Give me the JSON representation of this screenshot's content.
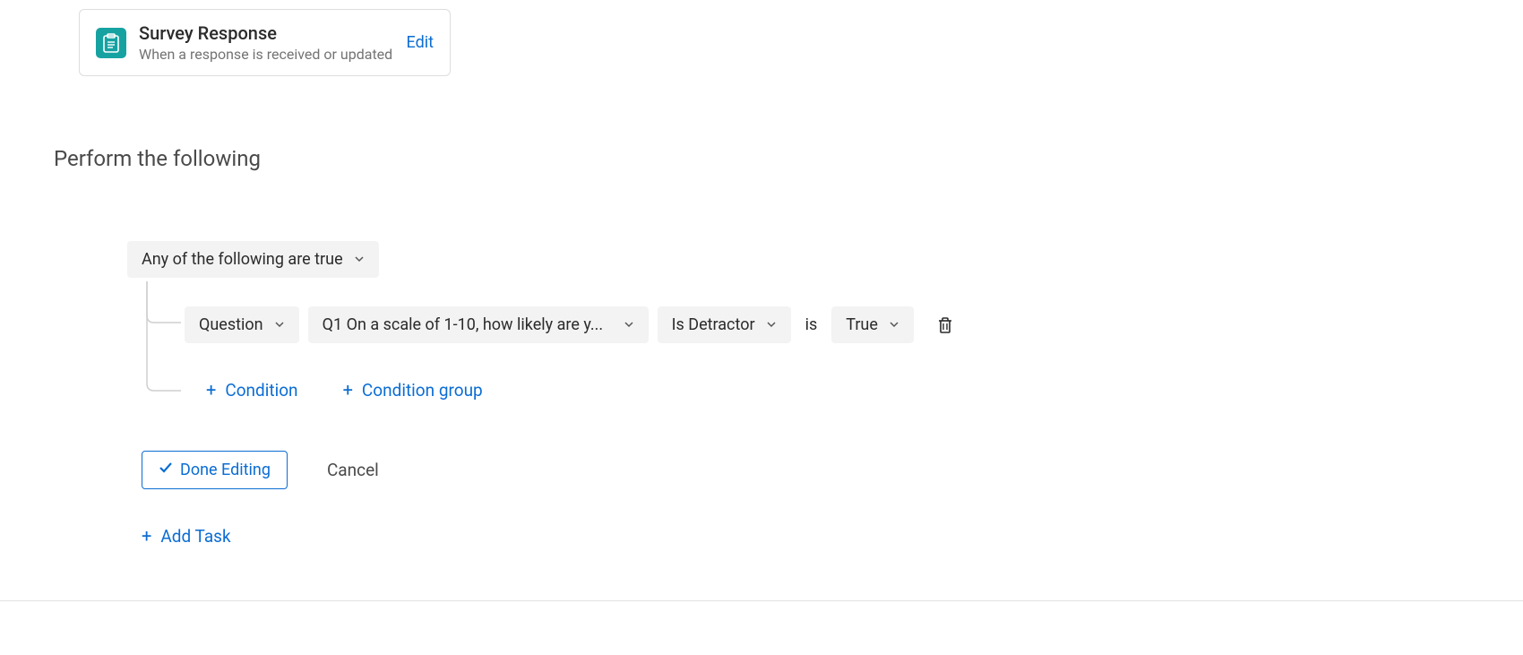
{
  "trigger": {
    "title": "Survey Response",
    "subtitle": "When a response is received or updated",
    "edit_label": "Edit"
  },
  "section_heading": "Perform the following",
  "condition_group": {
    "operator_label": "Any of the following are true",
    "rows": [
      {
        "source_type": "Question",
        "question_label": "Q1 On a scale of 1-10, how likely are y...",
        "metric_label": "Is Detractor",
        "comparator_label": "is",
        "value_label": "True"
      }
    ],
    "add_condition_label": "Condition",
    "add_condition_group_label": "Condition group"
  },
  "buttons": {
    "done_editing": "Done Editing",
    "cancel": "Cancel",
    "add_task": "Add Task"
  },
  "icons": {
    "plus": "+",
    "check": "✓"
  },
  "colors": {
    "primary": "#0b6dd3",
    "teal": "#17a2a2"
  }
}
